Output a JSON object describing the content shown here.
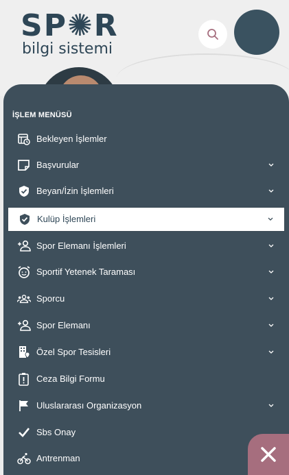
{
  "logo": {
    "main": "SP✺R",
    "sub": "bilgi sistemi"
  },
  "header": {
    "search_icon": "search-icon",
    "avatar": "user-avatar"
  },
  "menu": {
    "heading": "İŞLEM MENÜSÜ",
    "items": [
      {
        "label": "Bekleyen İşlemler",
        "icon": "calendar-clock-icon",
        "chevron": false
      },
      {
        "label": "Başvurular",
        "icon": "document-edit-icon",
        "chevron": true
      },
      {
        "label": "Beyan/İzin İşlemleri",
        "icon": "shield-check-icon",
        "chevron": true
      },
      {
        "label": "Kulüp İşlemleri",
        "icon": "shield-check-icon",
        "chevron": true,
        "active": true
      },
      {
        "label": "Spor Elemanı İşlemleri",
        "icon": "user-plus-icon",
        "chevron": true
      },
      {
        "label": "Sportif Yetenek Taraması",
        "icon": "alarm-face-icon",
        "chevron": true
      },
      {
        "label": "Sporcu",
        "icon": "users-icon",
        "chevron": true
      },
      {
        "label": "Spor Elemanı",
        "icon": "user-plus-icon",
        "chevron": true
      },
      {
        "label": "Özel Spor Tesisleri",
        "icon": "building-pin-icon",
        "chevron": true
      },
      {
        "label": "Ceza Bilgi Formu",
        "icon": "clipboard-alert-icon",
        "chevron": false
      },
      {
        "label": "Uluslararası Organizasyon",
        "icon": "flag-icon",
        "chevron": true
      },
      {
        "label": "Sbs Onay",
        "icon": "checkmark-icon",
        "chevron": false
      },
      {
        "label": "Antrenman",
        "icon": "cyclist-icon",
        "chevron": false
      }
    ]
  },
  "close": {
    "icon": "close-icon",
    "color": "#a66e7e"
  },
  "colors": {
    "menu_bg": "#3e4f5b",
    "brand": "#2e4656"
  }
}
